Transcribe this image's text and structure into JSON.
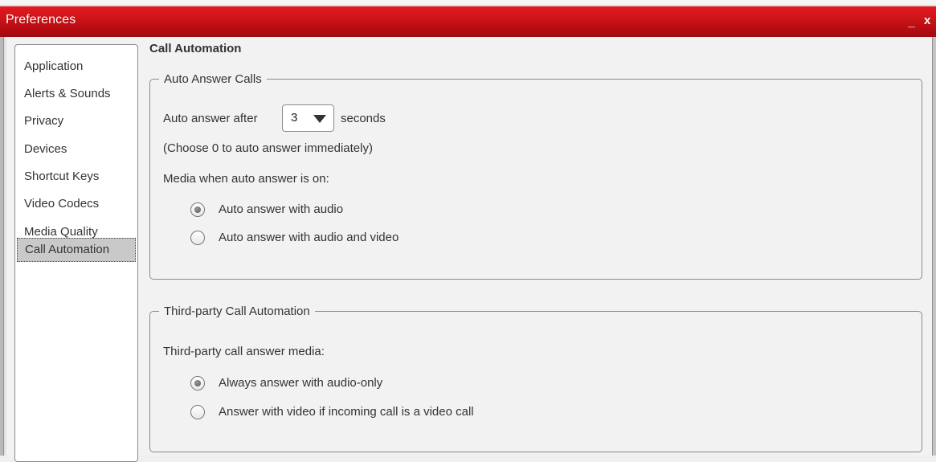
{
  "window": {
    "title": "Preferences",
    "minimize_label": "_",
    "close_label": "x"
  },
  "sidebar": {
    "items": [
      {
        "label": "Application"
      },
      {
        "label": "Alerts & Sounds"
      },
      {
        "label": "Privacy"
      },
      {
        "label": "Devices"
      },
      {
        "label": "Shortcut Keys"
      },
      {
        "label": "Video Codecs"
      },
      {
        "label": "Media Quality"
      },
      {
        "label": "Call Automation",
        "selected": true
      }
    ]
  },
  "main": {
    "title": "Call Automation",
    "auto_answer": {
      "legend": "Auto Answer Calls",
      "prefix": "Auto answer after",
      "delay_value": "3",
      "suffix": "seconds",
      "hint": "(Choose 0 to auto answer immediately)",
      "media_label": "Media when auto answer is on:",
      "options": [
        {
          "label": "Auto answer with audio",
          "checked": true
        },
        {
          "label": "Auto answer with audio and video",
          "checked": false
        }
      ]
    },
    "third_party": {
      "legend": "Third-party Call Automation",
      "media_label": "Third-party call answer media:",
      "options": [
        {
          "label": "Always answer with audio-only",
          "checked": true
        },
        {
          "label": "Answer with video if incoming call is a video call",
          "checked": false
        }
      ]
    }
  },
  "colors": {
    "titlebar": "#d2161a",
    "selection": "#c9c9c9"
  }
}
